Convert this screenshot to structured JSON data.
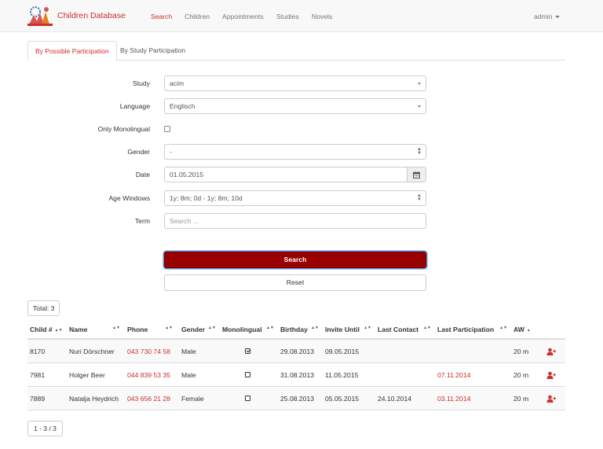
{
  "app": {
    "brand": "Children Database",
    "nav": [
      "Search",
      "Children",
      "Appointments",
      "Studies",
      "Novels"
    ],
    "user": "admin",
    "accent_color": "#c9302c",
    "search_button_color": "#990000"
  },
  "tabs": [
    "By Possible Participation",
    "By Study Participation"
  ],
  "form": {
    "study": {
      "label": "Study",
      "value": "acim"
    },
    "language": {
      "label": "Language",
      "value": "Englisch"
    },
    "mono": {
      "label": "Only Monolingual",
      "checked": false
    },
    "gender": {
      "label": "Gender",
      "value": "-"
    },
    "date": {
      "label": "Date",
      "value": "01.05.2015",
      "icon": "calendar-icon"
    },
    "age_windows": {
      "label": "Age Windows",
      "value": "1y; 8m; 0d - 1y; 8m; 10d"
    },
    "term": {
      "label": "Term",
      "placeholder": "Search ..."
    },
    "search_label": "Search",
    "reset_label": "Reset"
  },
  "total": "Total: 3",
  "table": {
    "columns": [
      "Child #",
      "Name",
      "Phone",
      "Gender",
      "Monolingual",
      "Birthday",
      "Invite Until",
      "Last Contact",
      "Last Participation",
      "AW"
    ],
    "rows": [
      {
        "child": "8170",
        "name": "Nuri Dörschner",
        "phone": "043 730 74 58",
        "gender": "Male",
        "monolingual": true,
        "birthday": "29.08.2013",
        "invite_until": "09.05.2015",
        "last_contact": "",
        "last_participation": "",
        "aw": "20 m"
      },
      {
        "child": "7981",
        "name": "Holger Beer",
        "phone": "044 839 53 35",
        "gender": "Male",
        "monolingual": false,
        "birthday": "31.08.2013",
        "invite_until": "11.05.2015",
        "last_contact": "",
        "last_participation": "07.11.2014",
        "aw": "20 m"
      },
      {
        "child": "7889",
        "name": "Natalja Heydrich",
        "phone": "043 656 21 28",
        "gender": "Female",
        "monolingual": false,
        "birthday": "25.08.2013",
        "invite_until": "05.05.2015",
        "last_contact": "24.10.2014",
        "last_participation": "03.11.2014",
        "aw": "20 m"
      }
    ]
  },
  "pager": "1 - 3 / 3"
}
